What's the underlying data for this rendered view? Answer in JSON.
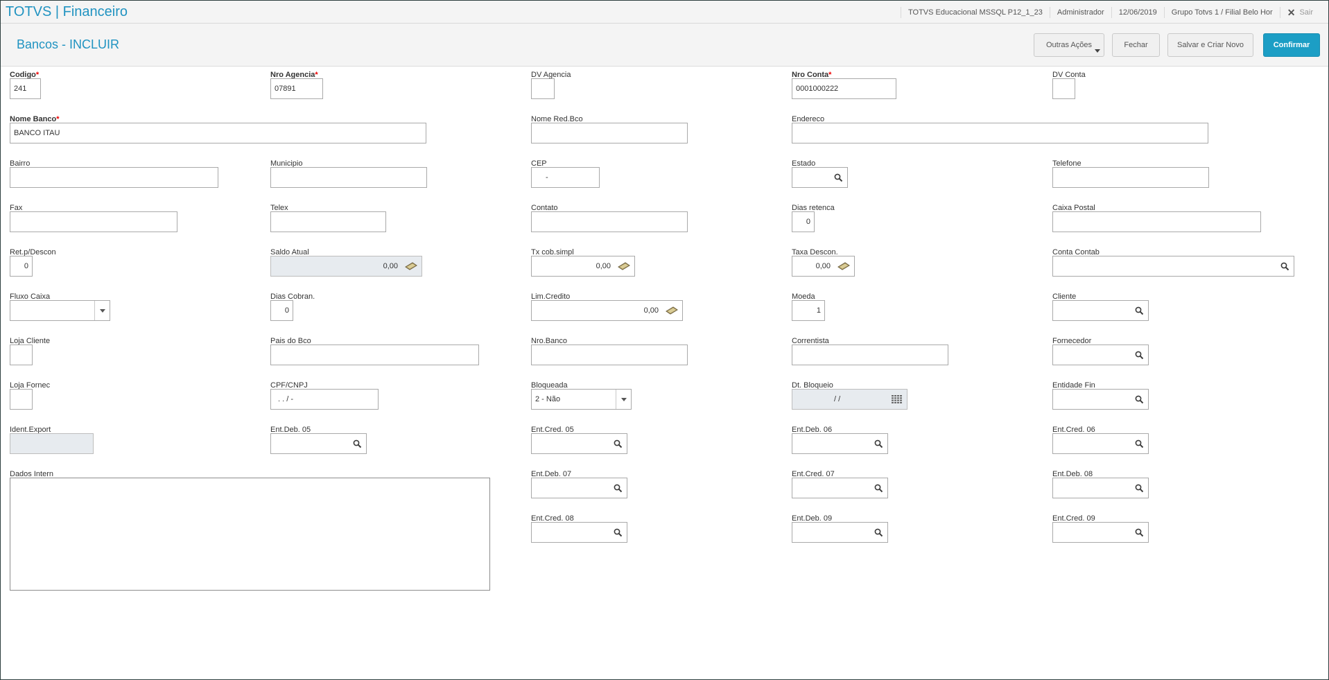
{
  "app": {
    "title": "TOTVS | Financeiro"
  },
  "topbar": {
    "environment": "TOTVS Educacional MSSQL P12_1_23",
    "user": "Administrador",
    "date": "12/06/2019",
    "branch": "Grupo Totvs 1 / Filial Belo Hor",
    "exit_label": "Sair"
  },
  "page": {
    "title": "Bancos - INCLUIR"
  },
  "buttons": {
    "other_actions": "Outras Ações",
    "close": "Fechar",
    "save_new": "Salvar e Criar Novo",
    "confirm": "Confirmar"
  },
  "form": {
    "codigo": {
      "label": "Codigo",
      "value": "241"
    },
    "nro_agencia": {
      "label": "Nro Agencia",
      "value": "07891"
    },
    "dv_agencia": {
      "label": "DV Agencia",
      "value": ""
    },
    "nro_conta": {
      "label": "Nro Conta",
      "value": "0001000222"
    },
    "dv_conta": {
      "label": "DV Conta",
      "value": ""
    },
    "nome_banco": {
      "label": "Nome Banco",
      "value": "BANCO ITAU"
    },
    "nome_red_bco": {
      "label": "Nome Red.Bco",
      "value": ""
    },
    "endereco": {
      "label": "Endereco",
      "value": ""
    },
    "bairro": {
      "label": "Bairro",
      "value": ""
    },
    "municipio": {
      "label": "Municipio",
      "value": ""
    },
    "cep": {
      "label": "CEP",
      "value": "-"
    },
    "estado": {
      "label": "Estado",
      "value": ""
    },
    "telefone": {
      "label": "Telefone",
      "value": ""
    },
    "fax": {
      "label": "Fax",
      "value": ""
    },
    "telex": {
      "label": "Telex",
      "value": ""
    },
    "contato": {
      "label": "Contato",
      "value": ""
    },
    "dias_retenca": {
      "label": "Dias retenca",
      "value": "0"
    },
    "caixa_postal": {
      "label": "Caixa Postal",
      "value": ""
    },
    "ret_p_descon": {
      "label": "Ret.p/Descon",
      "value": "0"
    },
    "saldo_atual": {
      "label": "Saldo Atual",
      "value": "0,00"
    },
    "tx_cob_simpl": {
      "label": "Tx cob.simpl",
      "value": "0,00"
    },
    "taxa_descon": {
      "label": "Taxa Descon.",
      "value": "0,00"
    },
    "conta_contab": {
      "label": "Conta Contab",
      "value": ""
    },
    "fluxo_caixa": {
      "label": "Fluxo Caixa",
      "value": ""
    },
    "dias_cobran": {
      "label": "Dias Cobran.",
      "value": "0"
    },
    "lim_credito": {
      "label": "Lim.Credito",
      "value": "0,00"
    },
    "moeda": {
      "label": "Moeda",
      "value": "1"
    },
    "cliente": {
      "label": "Cliente",
      "value": ""
    },
    "loja_cliente": {
      "label": "Loja Cliente",
      "value": ""
    },
    "pais_do_bco": {
      "label": "Pais do Bco",
      "value": ""
    },
    "nro_banco": {
      "label": "Nro.Banco",
      "value": ""
    },
    "correntista": {
      "label": "Correntista",
      "value": ""
    },
    "fornecedor": {
      "label": "Fornecedor",
      "value": ""
    },
    "loja_fornec": {
      "label": "Loja Fornec",
      "value": ""
    },
    "cpf_cnpj": {
      "label": "CPF/CNPJ",
      "value": ".  .  /   -"
    },
    "bloqueada": {
      "label": "Bloqueada",
      "value": "2 - Não"
    },
    "dt_bloqueio": {
      "label": "Dt. Bloqueio",
      "value": "/  /"
    },
    "entidade_fin": {
      "label": "Entidade Fin",
      "value": ""
    },
    "ident_export": {
      "label": "Ident.Export",
      "value": ""
    },
    "ent_deb_05": {
      "label": "Ent.Deb. 05",
      "value": ""
    },
    "ent_cred_05": {
      "label": "Ent.Cred. 05",
      "value": ""
    },
    "ent_deb_06": {
      "label": "Ent.Deb. 06",
      "value": ""
    },
    "ent_cred_06": {
      "label": "Ent.Cred. 06",
      "value": ""
    },
    "dados_intern": {
      "label": "Dados Intern",
      "value": ""
    },
    "ent_deb_07": {
      "label": "Ent.Deb. 07",
      "value": ""
    },
    "ent_cred_07": {
      "label": "Ent.Cred. 07",
      "value": ""
    },
    "ent_deb_08": {
      "label": "Ent.Deb. 08",
      "value": ""
    },
    "ent_cred_08": {
      "label": "Ent.Cred. 08",
      "value": ""
    },
    "ent_deb_09": {
      "label": "Ent.Deb. 09",
      "value": ""
    },
    "ent_cred_09": {
      "label": "Ent.Cred. 09",
      "value": ""
    }
  },
  "colors": {
    "brand": "#2093c1",
    "primary_button": "#1c9ec5",
    "required_star": "#ee0000"
  }
}
